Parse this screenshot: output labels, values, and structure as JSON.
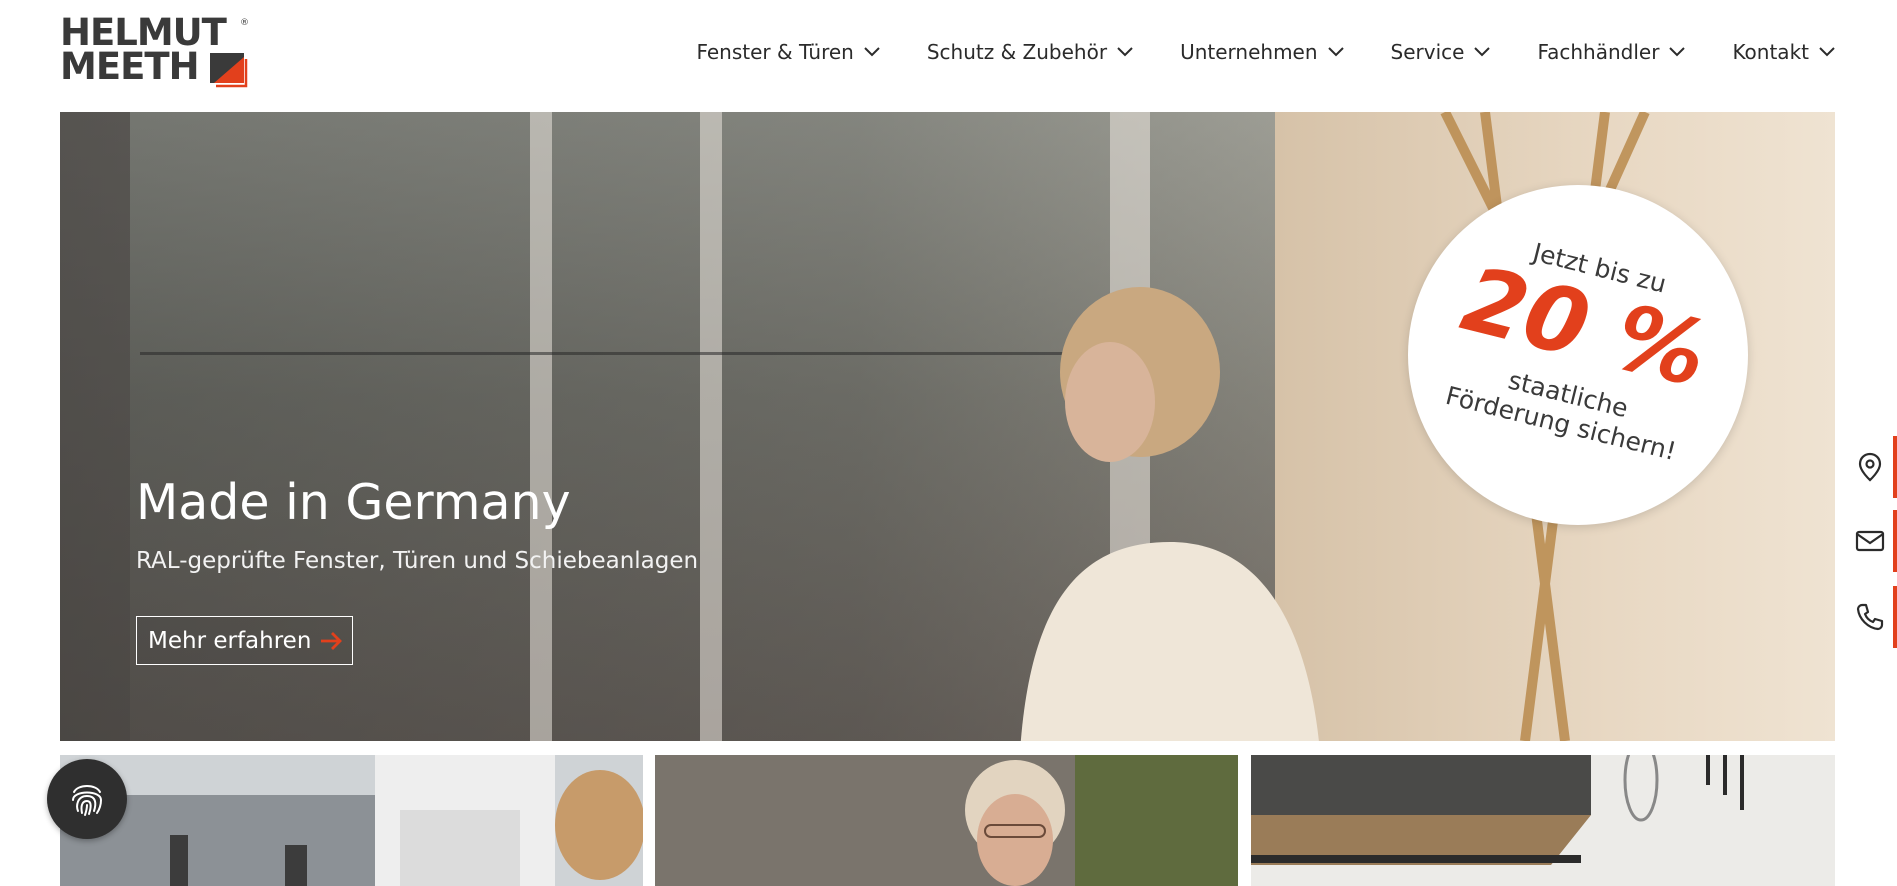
{
  "brand": {
    "logo_line1": "HELMUT",
    "logo_line2": "MEETH",
    "logo_reg": "®",
    "accent_color": "#e2401c"
  },
  "nav": {
    "items": [
      {
        "label": "Fenster & Türen",
        "icon": "chevron-down-icon"
      },
      {
        "label": "Schutz & Zubehör",
        "icon": "chevron-down-icon"
      },
      {
        "label": "Unternehmen",
        "icon": "chevron-down-icon"
      },
      {
        "label": "Service",
        "icon": "chevron-down-icon"
      },
      {
        "label": "Fachhändler",
        "icon": "chevron-down-icon"
      },
      {
        "label": "Kontakt",
        "icon": "chevron-down-icon"
      }
    ]
  },
  "hero": {
    "title": "Made in Germany",
    "subtitle": "RAL-geprüfte Fenster, Türen und Schiebeanlagen",
    "cta_label": "Mehr erfahren",
    "cta_icon": "arrow-right-icon"
  },
  "badge": {
    "line_top": "Jetzt bis zu",
    "big": "20 %",
    "line_1": "staatliche",
    "line_2": "Förderung sichern!"
  },
  "side_contact": {
    "icons": [
      "location-pin-icon",
      "mail-icon",
      "phone-icon"
    ]
  },
  "cookie": {
    "icon": "fingerprint-icon"
  }
}
